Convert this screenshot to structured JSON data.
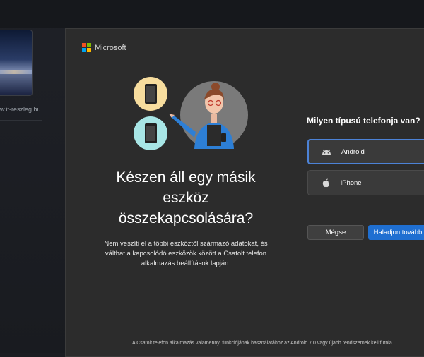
{
  "desktop": {
    "thumbnail_label": "w.it-reszleg.hu"
  },
  "dialog": {
    "brand": "Microsoft",
    "brand_colors": [
      "#f25022",
      "#7fba00",
      "#00a4ef",
      "#ffb900"
    ],
    "headline": "Készen áll egy másik eszköz összekapcsolására?",
    "body": "Nem veszíti el a többi eszköztől származó adatokat, és válthat a kapcsolódó eszközök között a Csatolt telefon alkalmazás beállítások lapján.",
    "question": "Milyen típusú telefonja van?",
    "options": [
      {
        "label": "Android",
        "icon": "android-icon",
        "selected": true
      },
      {
        "label": "iPhone",
        "icon": "apple-icon",
        "selected": false
      }
    ],
    "cancel_label": "Mégse",
    "continue_label": "Haladjon tovább",
    "footer": "A Csatolt telefon alkalmazás valamennyi funkciójának használatához az Android 7.0 vagy újabb rendszernek kell futnia",
    "accent_color": "#1f6fd1"
  }
}
